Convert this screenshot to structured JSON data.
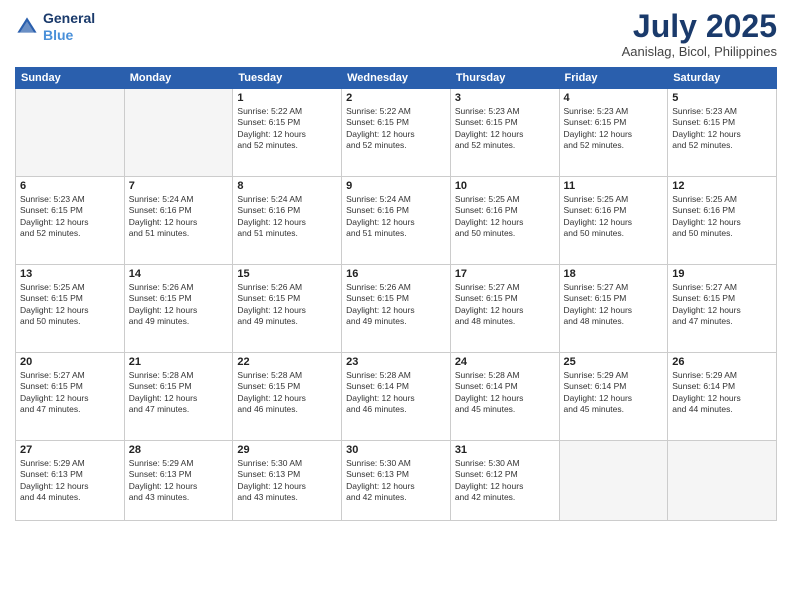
{
  "header": {
    "logo_line1": "General",
    "logo_line2": "Blue",
    "month": "July 2025",
    "location": "Aanislag, Bicol, Philippines"
  },
  "days_of_week": [
    "Sunday",
    "Monday",
    "Tuesday",
    "Wednesday",
    "Thursday",
    "Friday",
    "Saturday"
  ],
  "weeks": [
    [
      {
        "day": "",
        "info": ""
      },
      {
        "day": "",
        "info": ""
      },
      {
        "day": "1",
        "info": "Sunrise: 5:22 AM\nSunset: 6:15 PM\nDaylight: 12 hours\nand 52 minutes."
      },
      {
        "day": "2",
        "info": "Sunrise: 5:22 AM\nSunset: 6:15 PM\nDaylight: 12 hours\nand 52 minutes."
      },
      {
        "day": "3",
        "info": "Sunrise: 5:23 AM\nSunset: 6:15 PM\nDaylight: 12 hours\nand 52 minutes."
      },
      {
        "day": "4",
        "info": "Sunrise: 5:23 AM\nSunset: 6:15 PM\nDaylight: 12 hours\nand 52 minutes."
      },
      {
        "day": "5",
        "info": "Sunrise: 5:23 AM\nSunset: 6:15 PM\nDaylight: 12 hours\nand 52 minutes."
      }
    ],
    [
      {
        "day": "6",
        "info": "Sunrise: 5:23 AM\nSunset: 6:15 PM\nDaylight: 12 hours\nand 52 minutes."
      },
      {
        "day": "7",
        "info": "Sunrise: 5:24 AM\nSunset: 6:16 PM\nDaylight: 12 hours\nand 51 minutes."
      },
      {
        "day": "8",
        "info": "Sunrise: 5:24 AM\nSunset: 6:16 PM\nDaylight: 12 hours\nand 51 minutes."
      },
      {
        "day": "9",
        "info": "Sunrise: 5:24 AM\nSunset: 6:16 PM\nDaylight: 12 hours\nand 51 minutes."
      },
      {
        "day": "10",
        "info": "Sunrise: 5:25 AM\nSunset: 6:16 PM\nDaylight: 12 hours\nand 50 minutes."
      },
      {
        "day": "11",
        "info": "Sunrise: 5:25 AM\nSunset: 6:16 PM\nDaylight: 12 hours\nand 50 minutes."
      },
      {
        "day": "12",
        "info": "Sunrise: 5:25 AM\nSunset: 6:16 PM\nDaylight: 12 hours\nand 50 minutes."
      }
    ],
    [
      {
        "day": "13",
        "info": "Sunrise: 5:25 AM\nSunset: 6:15 PM\nDaylight: 12 hours\nand 50 minutes."
      },
      {
        "day": "14",
        "info": "Sunrise: 5:26 AM\nSunset: 6:15 PM\nDaylight: 12 hours\nand 49 minutes."
      },
      {
        "day": "15",
        "info": "Sunrise: 5:26 AM\nSunset: 6:15 PM\nDaylight: 12 hours\nand 49 minutes."
      },
      {
        "day": "16",
        "info": "Sunrise: 5:26 AM\nSunset: 6:15 PM\nDaylight: 12 hours\nand 49 minutes."
      },
      {
        "day": "17",
        "info": "Sunrise: 5:27 AM\nSunset: 6:15 PM\nDaylight: 12 hours\nand 48 minutes."
      },
      {
        "day": "18",
        "info": "Sunrise: 5:27 AM\nSunset: 6:15 PM\nDaylight: 12 hours\nand 48 minutes."
      },
      {
        "day": "19",
        "info": "Sunrise: 5:27 AM\nSunset: 6:15 PM\nDaylight: 12 hours\nand 47 minutes."
      }
    ],
    [
      {
        "day": "20",
        "info": "Sunrise: 5:27 AM\nSunset: 6:15 PM\nDaylight: 12 hours\nand 47 minutes."
      },
      {
        "day": "21",
        "info": "Sunrise: 5:28 AM\nSunset: 6:15 PM\nDaylight: 12 hours\nand 47 minutes."
      },
      {
        "day": "22",
        "info": "Sunrise: 5:28 AM\nSunset: 6:15 PM\nDaylight: 12 hours\nand 46 minutes."
      },
      {
        "day": "23",
        "info": "Sunrise: 5:28 AM\nSunset: 6:14 PM\nDaylight: 12 hours\nand 46 minutes."
      },
      {
        "day": "24",
        "info": "Sunrise: 5:28 AM\nSunset: 6:14 PM\nDaylight: 12 hours\nand 45 minutes."
      },
      {
        "day": "25",
        "info": "Sunrise: 5:29 AM\nSunset: 6:14 PM\nDaylight: 12 hours\nand 45 minutes."
      },
      {
        "day": "26",
        "info": "Sunrise: 5:29 AM\nSunset: 6:14 PM\nDaylight: 12 hours\nand 44 minutes."
      }
    ],
    [
      {
        "day": "27",
        "info": "Sunrise: 5:29 AM\nSunset: 6:13 PM\nDaylight: 12 hours\nand 44 minutes."
      },
      {
        "day": "28",
        "info": "Sunrise: 5:29 AM\nSunset: 6:13 PM\nDaylight: 12 hours\nand 43 minutes."
      },
      {
        "day": "29",
        "info": "Sunrise: 5:30 AM\nSunset: 6:13 PM\nDaylight: 12 hours\nand 43 minutes."
      },
      {
        "day": "30",
        "info": "Sunrise: 5:30 AM\nSunset: 6:13 PM\nDaylight: 12 hours\nand 42 minutes."
      },
      {
        "day": "31",
        "info": "Sunrise: 5:30 AM\nSunset: 6:12 PM\nDaylight: 12 hours\nand 42 minutes."
      },
      {
        "day": "",
        "info": ""
      },
      {
        "day": "",
        "info": ""
      }
    ]
  ]
}
